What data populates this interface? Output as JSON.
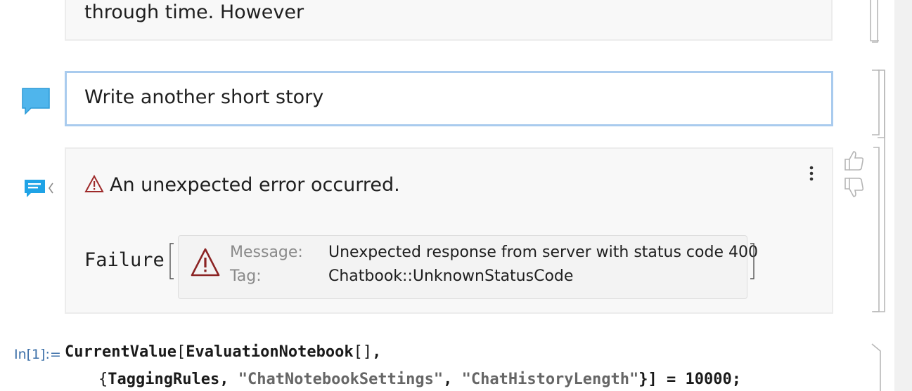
{
  "notebook": {
    "previous_cell": {
      "text": "through time. However"
    },
    "chat_input": {
      "text": "Write another short story"
    },
    "chat_output": {
      "error_message": "An unexpected error occurred.",
      "failure": {
        "head": "Failure",
        "message_label": "Message:",
        "message_value": "Unexpected response from server with status code 400",
        "tag_label": "Tag:",
        "tag_value": "Chatbook::UnknownStatusCode"
      },
      "icons": [
        "warning-icon",
        "more-options-icon",
        "thumbs-up-icon",
        "thumbs-down-icon"
      ]
    },
    "input_cell": {
      "label": "In[1]:=",
      "line1": {
        "fn": "CurrentValue",
        "open1": "[",
        "arg1": "EvaluationNotebook",
        "brackets_empty": "[]",
        "comma": ","
      },
      "line2": {
        "open_brace": "{",
        "sym": "TaggingRules",
        "sep1": ", ",
        "str1": "\"ChatNotebookSettings\"",
        "sep2": ", ",
        "str2": "\"ChatHistoryLength\"",
        "close": "}] = ",
        "value": "10000",
        "semicolon": ";"
      }
    }
  },
  "colors": {
    "input_border": "#a9cbee",
    "chat_icon": "#29a9e8",
    "error_red": "#9e2a2a",
    "in_label": "#3b6fa8"
  }
}
